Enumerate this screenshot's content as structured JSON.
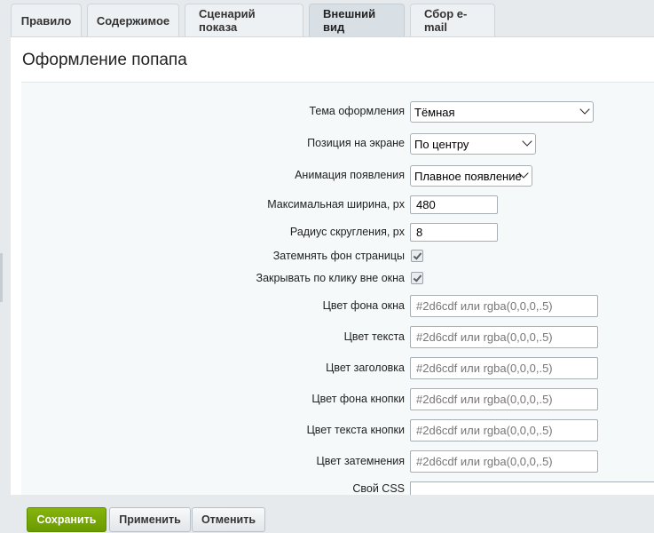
{
  "tabs": [
    {
      "label": "Правило",
      "active": false
    },
    {
      "label": "Содержимое",
      "active": false
    },
    {
      "label": "Сценарий показа",
      "active": false
    },
    {
      "label": "Внешний вид",
      "active": true
    },
    {
      "label": "Сбор e-mail",
      "active": false
    }
  ],
  "panel": {
    "title": "Оформление попапа"
  },
  "form": {
    "theme": {
      "label": "Тема оформления",
      "value": "Тёмная"
    },
    "position": {
      "label": "Позиция на экране",
      "value": "По центру"
    },
    "animation": {
      "label": "Анимация появления",
      "value": "Плавное появление"
    },
    "max_width": {
      "label": "Максимальная ширина, px",
      "value": "480"
    },
    "radius": {
      "label": "Радиус скругления, px",
      "value": "8"
    },
    "dim_bg": {
      "label": "Затемнять фон страницы",
      "checked": true
    },
    "close_outside": {
      "label": "Закрывать по клику вне окна",
      "checked": true
    },
    "window_bg_color": {
      "label": "Цвет фона окна",
      "placeholder": "#2d6cdf или rgba(0,0,0,.5)"
    },
    "text_color": {
      "label": "Цвет текста",
      "placeholder": "#2d6cdf или rgba(0,0,0,.5)"
    },
    "heading_color": {
      "label": "Цвет заголовка",
      "placeholder": "#2d6cdf или rgba(0,0,0,.5)"
    },
    "button_bg_color": {
      "label": "Цвет фона кнопки",
      "placeholder": "#2d6cdf или rgba(0,0,0,.5)"
    },
    "button_text_color": {
      "label": "Цвет текста кнопки",
      "placeholder": "#2d6cdf или rgba(0,0,0,.5)"
    },
    "overlay_color": {
      "label": "Цвет затемнения",
      "placeholder": "#2d6cdf или rgba(0,0,0,.5)"
    },
    "custom_css": {
      "label": "Свой CSS",
      "value": ""
    }
  },
  "actions": {
    "save": "Сохранить",
    "apply": "Применить",
    "cancel": "Отменить"
  },
  "colors": {
    "primary_button": "#75a500",
    "page_background": "#e6eaed",
    "form_background": "#f5f9f9"
  }
}
